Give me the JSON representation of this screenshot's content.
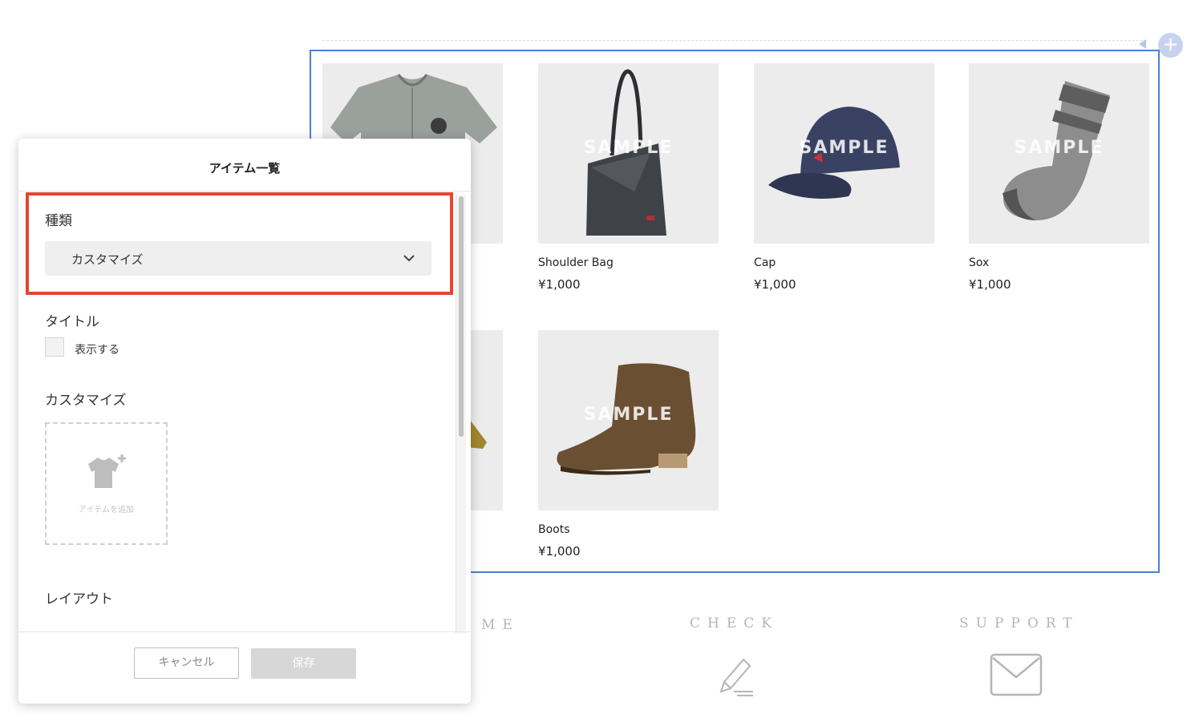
{
  "item_list": {
    "products": [
      {
        "name": "",
        "price": "",
        "watermark": "",
        "image": "shirt-image"
      },
      {
        "name": "Shoulder Bag",
        "price": "¥1,000",
        "watermark": "SAMPLE",
        "image": "bag-image"
      },
      {
        "name": "Cap",
        "price": "¥1,000",
        "watermark": "SAMPLE",
        "image": "cap-image"
      },
      {
        "name": "Sox",
        "price": "¥1,000",
        "watermark": "SAMPLE",
        "image": "socks-image"
      },
      {
        "name": "",
        "price": "",
        "watermark": "",
        "image": "partial-image"
      },
      {
        "name": "Boots",
        "price": "¥1,000",
        "watermark": "SAMPLE",
        "image": "boots-image"
      }
    ],
    "add_button_icon": "plus-icon"
  },
  "footer": {
    "welcome_fragment": "ME",
    "check": "CHECK",
    "support": "SUPPORT",
    "check_icon": "pencil-icon",
    "support_icon": "envelope-icon"
  },
  "panel": {
    "title": "アイテム一覧",
    "type_label": "種類",
    "type_value": "カスタマイズ",
    "title_label": "タイトル",
    "show_label": "表示する",
    "show_checked": false,
    "customize_label": "カスタマイズ",
    "add_item_text": "アイテムを追加",
    "layout_label": "レイアウト",
    "cancel_label": "キャンセル",
    "save_label": "保存"
  },
  "colors": {
    "selection_border": "#4a7fd4",
    "highlight_border": "#e8442f",
    "save_disabled": "#d7d7d7"
  }
}
